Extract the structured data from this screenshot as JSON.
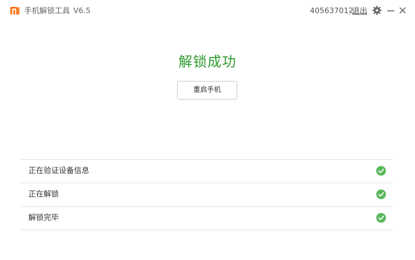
{
  "titlebar": {
    "app_title": "手机解锁工具",
    "version": "V6.5",
    "account_id": "405637012",
    "logout_label": "退出",
    "brand_color": "#ff6700",
    "icons": [
      "mi-logo-icon",
      "gear-icon",
      "minimize-icon",
      "close-icon"
    ]
  },
  "main": {
    "status_title": "解锁成功",
    "status_color": "#2e9a2e",
    "reboot_button_label": "重启手机"
  },
  "steps": [
    {
      "label": "正在验证设备信息",
      "status": "done",
      "icon": "check-circle-icon"
    },
    {
      "label": "正在解锁",
      "status": "done",
      "icon": "check-circle-icon"
    },
    {
      "label": "解锁完毕",
      "status": "done",
      "icon": "check-circle-icon"
    }
  ],
  "check_color": "#5cb85c"
}
